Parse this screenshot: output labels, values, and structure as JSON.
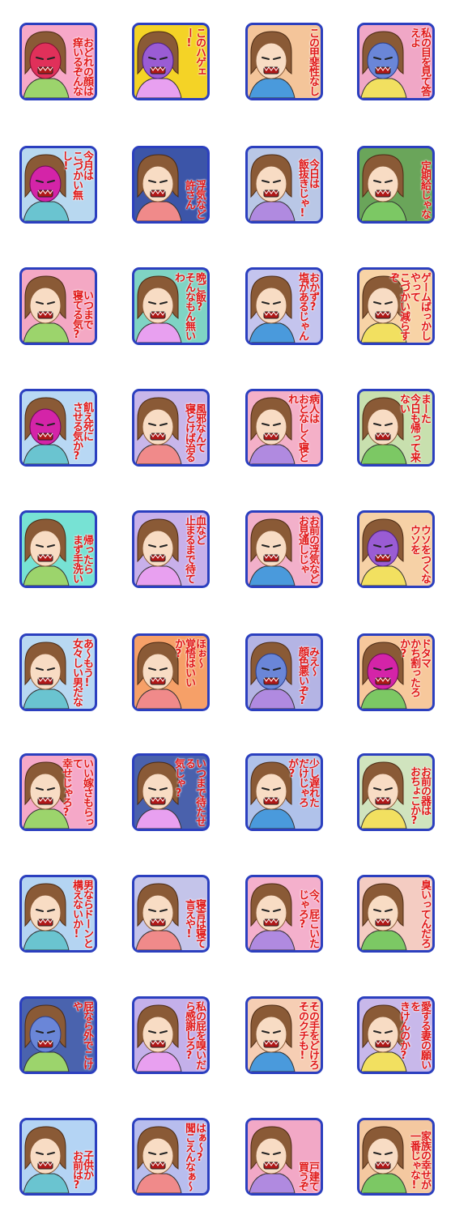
{
  "stickers": [
    {
      "text": "おどれの顔は\n痒いるぞんな",
      "bg": "#f7a8c8",
      "face": "red"
    },
    {
      "text": "このハゲェー!",
      "bg": "#f4d326",
      "face": "purple"
    },
    {
      "text": "この甲斐性なし",
      "bg": "#f4c59a",
      "face": "skin"
    },
    {
      "text": "私の目を見て答えよ",
      "bg": "#f0a7c6",
      "face": "blue"
    },
    {
      "text": "今月は\nこづかい無し!",
      "bg": "#b8d8f0",
      "face": "magenta"
    },
    {
      "text": "浮気など\n許さん",
      "bg": "#3c55a8",
      "face": "skin"
    },
    {
      "text": "今日は\n飯抜きじゃ!",
      "bg": "#b9c7e6",
      "face": "skin"
    },
    {
      "text": "定期給じゃな",
      "bg": "#6aa55a",
      "face": "skin"
    },
    {
      "text": "いつまで\n寝てる気?",
      "bg": "#f4a8c4",
      "face": "skin"
    },
    {
      "text": "晩ご飯?\nそんなもん無いわ",
      "bg": "#7fd4c4",
      "face": "skin"
    },
    {
      "text": "おかず?\n塩があるじゃん",
      "bg": "#c4c4ee",
      "face": "skin"
    },
    {
      "text": "ゲームばっかしやって\nこづかい減らすぞ",
      "bg": "#f8d3a6",
      "face": "skin"
    },
    {
      "text": "飢え死に\nさせる気か?",
      "bg": "#b8d8f4",
      "face": "magenta"
    },
    {
      "text": "風邪なんて\n寝とけば治る",
      "bg": "#c8b6ea",
      "face": "skin"
    },
    {
      "text": "病人は\nおとなしく寝とれ",
      "bg": "#f4b0c8",
      "face": "skin"
    },
    {
      "text": "まーた\n今日も帰って来ない",
      "bg": "#c8e0ae",
      "face": "skin"
    },
    {
      "text": "帰ったら\nまず手洗い",
      "bg": "#77e2d4",
      "face": "skin"
    },
    {
      "text": "血など\n止まるまで待て",
      "bg": "#c8b0ea",
      "face": "skin"
    },
    {
      "text": "お前の浮気など\nお見通しじゃ",
      "bg": "#f2b0ca",
      "face": "skin"
    },
    {
      "text": "ウソをつくな\nウソを",
      "bg": "#f6d1a6",
      "face": "purple"
    },
    {
      "text": "あ〜もう!\n女々しい男だな",
      "bg": "#b8d8f2",
      "face": "skin"
    },
    {
      "text": "ほぉ〜\n覚悟はいいか?",
      "bg": "#f6a068",
      "face": "skin"
    },
    {
      "text": "みえ〜\n顔色悪いぞ?",
      "bg": "#b4b4e4",
      "face": "blue"
    },
    {
      "text": "ドタマ\nかち割ったろか?",
      "bg": "#f7c89c",
      "face": "magenta"
    },
    {
      "text": "いい嫁さもらって\n幸せじゃろ?",
      "bg": "#f5a8c8",
      "face": "skin"
    },
    {
      "text": "いつまで待たせる\n気じゃ?",
      "bg": "#4a61ac",
      "face": "skin"
    },
    {
      "text": "少し遅れた\nだけじゃろが?",
      "bg": "#b0c2ea",
      "face": "skin"
    },
    {
      "text": "お前の器は\nおちょこか?",
      "bg": "#d0e4be",
      "face": "skin"
    },
    {
      "text": "男ならドーンと\n構えないか!",
      "bg": "#b4d4f2",
      "face": "skin"
    },
    {
      "text": "寝言は寝て\n言えや!",
      "bg": "#c4c4ea",
      "face": "skin"
    },
    {
      "text": "今、屁こいた\nじゃろ?",
      "bg": "#f4b0cc",
      "face": "skin"
    },
    {
      "text": "臭いってんだろ",
      "bg": "#f4ccc2",
      "face": "skin"
    },
    {
      "text": "屁なら外でこけや",
      "bg": "#4a63ae",
      "face": "blue"
    },
    {
      "text": "私の屁を嗅いだ\nら感謝しろ?",
      "bg": "#c4b0ea",
      "face": "skin"
    },
    {
      "text": "その手をどけろ\nそのクチも!",
      "bg": "#f6ceb4",
      "face": "skin"
    },
    {
      "text": "愛する妻の願いを\nきけんのか?",
      "bg": "#c8b8ea",
      "face": "skin"
    },
    {
      "text": "子供か\nお前は?",
      "bg": "#b4d4f4",
      "face": "skin"
    },
    {
      "text": "はぁ〜?\n聞こえんなぁ〜",
      "bg": "#b8bdee",
      "face": "skin"
    },
    {
      "text": "戸建て\n買うぞ",
      "bg": "#f2a8c6",
      "face": "skin"
    },
    {
      "text": "家族の幸せが\n一番じゃな!",
      "bg": "#f4c8a0",
      "face": "skin"
    }
  ],
  "colors": {
    "border": "#2b3fbf",
    "caption": "#e01818",
    "hair": "#8a5a36",
    "skin": "#f8dcc4"
  }
}
